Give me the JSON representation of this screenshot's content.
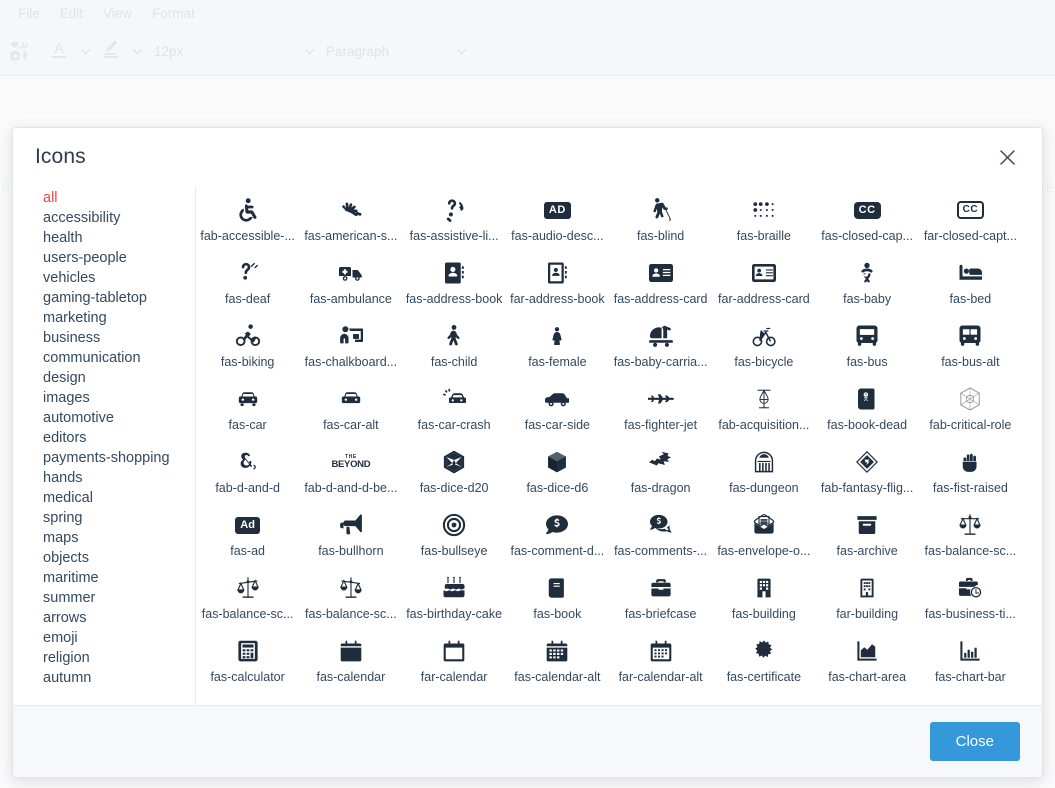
{
  "editor": {
    "menubar": [
      "File",
      "Edit",
      "View",
      "Format"
    ],
    "toolbar": {
      "insert_media_icon": "insert-media-icon",
      "text_color_label": "A",
      "highlight_color_icon": "highlight-pen-icon",
      "font_size_value": "12px",
      "block_format_value": "Paragraph",
      "caret_icon": "chevron-down-icon"
    },
    "ghost_letters": [
      "P",
      "E"
    ]
  },
  "dialog": {
    "title": "Icons",
    "close_icon": "close-icon",
    "close_button_label": "Close",
    "accent_color": "#3498db",
    "active_category_color": "#e8483d"
  },
  "categories": [
    {
      "label": "all",
      "active": true
    },
    {
      "label": "accessibility",
      "active": false
    },
    {
      "label": "health",
      "active": false
    },
    {
      "label": "users-people",
      "active": false
    },
    {
      "label": "vehicles",
      "active": false
    },
    {
      "label": "gaming-tabletop",
      "active": false
    },
    {
      "label": "marketing",
      "active": false
    },
    {
      "label": "business",
      "active": false
    },
    {
      "label": "communication",
      "active": false
    },
    {
      "label": "design",
      "active": false
    },
    {
      "label": "images",
      "active": false
    },
    {
      "label": "automotive",
      "active": false
    },
    {
      "label": "editors",
      "active": false
    },
    {
      "label": "payments-shopping",
      "active": false
    },
    {
      "label": "hands",
      "active": false
    },
    {
      "label": "medical",
      "active": false
    },
    {
      "label": "spring",
      "active": false
    },
    {
      "label": "maps",
      "active": false
    },
    {
      "label": "objects",
      "active": false
    },
    {
      "label": "maritime",
      "active": false
    },
    {
      "label": "summer",
      "active": false
    },
    {
      "label": "arrows",
      "active": false
    },
    {
      "label": "emoji",
      "active": false
    },
    {
      "label": "religion",
      "active": false
    },
    {
      "label": "autumn",
      "active": false
    }
  ],
  "icons": [
    {
      "label": "fab-accessible-...",
      "glyph": "accessible-icon"
    },
    {
      "label": "fas-american-s...",
      "glyph": "american-sign-language-icon"
    },
    {
      "label": "fas-assistive-li...",
      "glyph": "assistive-listening-systems-icon"
    },
    {
      "label": "fas-audio-desc...",
      "glyph": "audio-description-icon"
    },
    {
      "label": "fas-blind",
      "glyph": "blind-icon"
    },
    {
      "label": "fas-braille",
      "glyph": "braille-icon"
    },
    {
      "label": "fas-closed-cap...",
      "glyph": "closed-captioning-solid-icon"
    },
    {
      "label": "far-closed-capt...",
      "glyph": "closed-captioning-regular-icon"
    },
    {
      "label": "fas-deaf",
      "glyph": "deaf-icon"
    },
    {
      "label": "fas-ambulance",
      "glyph": "ambulance-icon"
    },
    {
      "label": "fas-address-book",
      "glyph": "address-book-solid-icon"
    },
    {
      "label": "far-address-book",
      "glyph": "address-book-regular-icon"
    },
    {
      "label": "fas-address-card",
      "glyph": "address-card-solid-icon"
    },
    {
      "label": "far-address-card",
      "glyph": "address-card-regular-icon"
    },
    {
      "label": "fas-baby",
      "glyph": "baby-icon"
    },
    {
      "label": "fas-bed",
      "glyph": "bed-icon"
    },
    {
      "label": "fas-biking",
      "glyph": "biking-icon"
    },
    {
      "label": "fas-chalkboard...",
      "glyph": "chalkboard-teacher-icon"
    },
    {
      "label": "fas-child",
      "glyph": "child-icon"
    },
    {
      "label": "fas-female",
      "glyph": "female-icon"
    },
    {
      "label": "fas-baby-carria...",
      "glyph": "baby-carriage-icon"
    },
    {
      "label": "fas-bicycle",
      "glyph": "bicycle-icon"
    },
    {
      "label": "fas-bus",
      "glyph": "bus-icon"
    },
    {
      "label": "fas-bus-alt",
      "glyph": "bus-alt-icon"
    },
    {
      "label": "fas-car",
      "glyph": "car-icon"
    },
    {
      "label": "fas-car-alt",
      "glyph": "car-alt-icon"
    },
    {
      "label": "fas-car-crash",
      "glyph": "car-crash-icon"
    },
    {
      "label": "fas-car-side",
      "glyph": "car-side-icon"
    },
    {
      "label": "fas-fighter-jet",
      "glyph": "fighter-jet-icon"
    },
    {
      "label": "fab-acquisition...",
      "glyph": "acquisitions-incorporated-icon"
    },
    {
      "label": "fas-book-dead",
      "glyph": "book-dead-icon"
    },
    {
      "label": "fab-critical-role",
      "glyph": "critical-role-icon"
    },
    {
      "label": "fab-d-and-d",
      "glyph": "d-and-d-icon"
    },
    {
      "label": "fab-d-and-d-be...",
      "glyph": "d-and-d-beyond-icon"
    },
    {
      "label": "fas-dice-d20",
      "glyph": "dice-d20-icon"
    },
    {
      "label": "fas-dice-d6",
      "glyph": "dice-d6-icon"
    },
    {
      "label": "fas-dragon",
      "glyph": "dragon-icon"
    },
    {
      "label": "fas-dungeon",
      "glyph": "dungeon-icon"
    },
    {
      "label": "fab-fantasy-flig...",
      "glyph": "fantasy-flight-games-icon"
    },
    {
      "label": "fas-fist-raised",
      "glyph": "fist-raised-icon"
    },
    {
      "label": "fas-ad",
      "glyph": "ad-icon"
    },
    {
      "label": "fas-bullhorn",
      "glyph": "bullhorn-icon"
    },
    {
      "label": "fas-bullseye",
      "glyph": "bullseye-icon"
    },
    {
      "label": "fas-comment-d...",
      "glyph": "comment-dollar-icon"
    },
    {
      "label": "fas-comments-...",
      "glyph": "comments-dollar-icon"
    },
    {
      "label": "fas-envelope-o...",
      "glyph": "envelope-open-text-icon"
    },
    {
      "label": "fas-archive",
      "glyph": "archive-icon"
    },
    {
      "label": "fas-balance-sc...",
      "glyph": "balance-scale-icon"
    },
    {
      "label": "fas-balance-sc...",
      "glyph": "balance-scale-left-icon"
    },
    {
      "label": "fas-balance-sc...",
      "glyph": "balance-scale-right-icon"
    },
    {
      "label": "fas-birthday-cake",
      "glyph": "birthday-cake-icon"
    },
    {
      "label": "fas-book",
      "glyph": "book-icon"
    },
    {
      "label": "fas-briefcase",
      "glyph": "briefcase-icon"
    },
    {
      "label": "fas-building",
      "glyph": "building-solid-icon"
    },
    {
      "label": "far-building",
      "glyph": "building-regular-icon"
    },
    {
      "label": "fas-business-ti...",
      "glyph": "business-time-icon"
    },
    {
      "label": "fas-calculator",
      "glyph": "calculator-icon"
    },
    {
      "label": "fas-calendar",
      "glyph": "calendar-solid-icon"
    },
    {
      "label": "far-calendar",
      "glyph": "calendar-regular-icon"
    },
    {
      "label": "fas-calendar-alt",
      "glyph": "calendar-alt-solid-icon"
    },
    {
      "label": "far-calendar-alt",
      "glyph": "calendar-alt-regular-icon"
    },
    {
      "label": "fas-certificate",
      "glyph": "certificate-icon"
    },
    {
      "label": "fas-chart-area",
      "glyph": "chart-area-icon"
    },
    {
      "label": "fas-chart-bar",
      "glyph": "chart-bar-icon"
    }
  ]
}
